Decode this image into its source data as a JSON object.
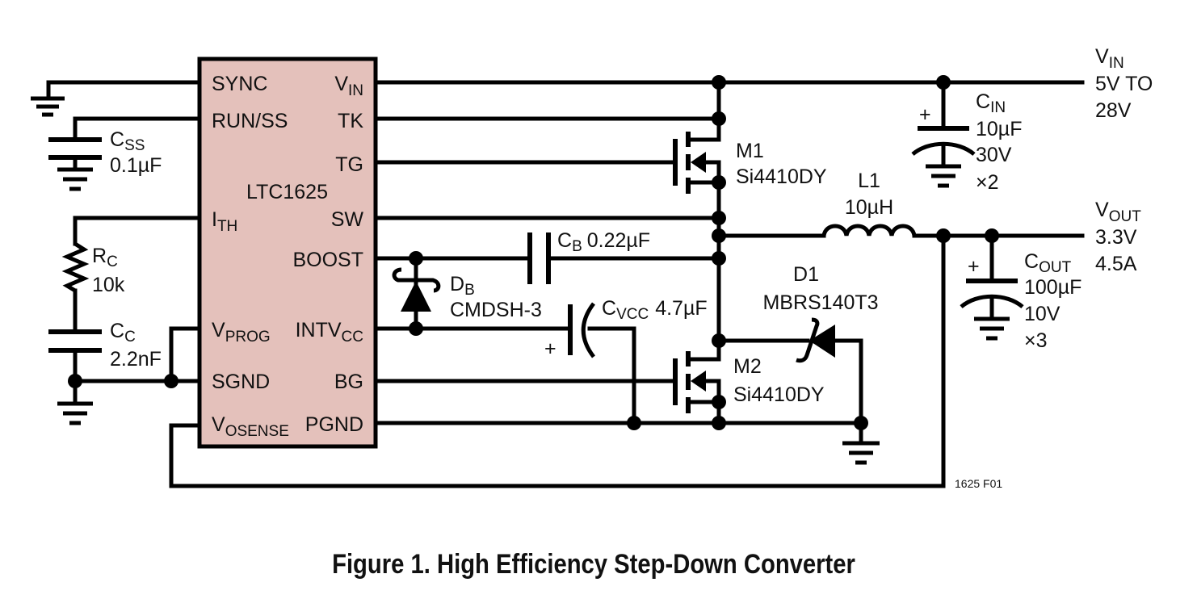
{
  "colors": {
    "ic_fill": "#e4c1bb",
    "wire": "#000000"
  },
  "ic": {
    "name": "LTC1625",
    "left_pins": [
      {
        "main": "SYNC",
        "sub": ""
      },
      {
        "main": "RUN/SS",
        "sub": ""
      },
      {
        "main": "I",
        "sub": "TH"
      },
      {
        "main": "V",
        "sub": "PROG"
      },
      {
        "main": "SGND",
        "sub": ""
      },
      {
        "main": "V",
        "sub": "OSENSE"
      }
    ],
    "right_pins": [
      {
        "main": "V",
        "sub": "IN"
      },
      {
        "main": "TK",
        "sub": ""
      },
      {
        "main": "TG",
        "sub": ""
      },
      {
        "main": "SW",
        "sub": ""
      },
      {
        "main": "BOOST",
        "sub": ""
      },
      {
        "main": "INTV",
        "sub": "CC"
      },
      {
        "main": "BG",
        "sub": ""
      },
      {
        "main": "PGND",
        "sub": ""
      }
    ]
  },
  "components": {
    "css": {
      "ref": "C",
      "ref_sub": "SS",
      "value": "0.1µF"
    },
    "rc": {
      "ref": "R",
      "ref_sub": "C",
      "value": "10k"
    },
    "cc": {
      "ref": "C",
      "ref_sub": "C",
      "value": "2.2nF"
    },
    "cb": {
      "ref": "C",
      "ref_sub": "B",
      "value": "0.22µF"
    },
    "db": {
      "ref": "D",
      "ref_sub": "B",
      "value": "CMDSH-3"
    },
    "cvcc": {
      "ref": "C",
      "ref_sub": "VCC",
      "value": "4.7µF",
      "polarity": "+"
    },
    "m1": {
      "ref": "M1",
      "value": "Si4410DY"
    },
    "m2": {
      "ref": "M2",
      "value": "Si4410DY"
    },
    "l1": {
      "ref": "L1",
      "value": "10µH"
    },
    "d1": {
      "ref": "D1",
      "value": "MBRS140T3"
    },
    "cin": {
      "ref": "C",
      "ref_sub": "IN",
      "value": "10µF",
      "voltage": "30V",
      "count": "×2",
      "polarity": "+"
    },
    "cout": {
      "ref": "C",
      "ref_sub": "OUT",
      "value": "100µF",
      "voltage": "10V",
      "count": "×3",
      "polarity": "+"
    }
  },
  "terminals": {
    "vin": {
      "main": "V",
      "sub": "IN",
      "line1": "5V TO",
      "line2": "28V"
    },
    "vout": {
      "main": "V",
      "sub": "OUT",
      "line1": "3.3V",
      "line2": "4.5A"
    }
  },
  "figure_id": "1625 F01",
  "caption": "Figure 1. High Efficiency Step-Down Converter"
}
